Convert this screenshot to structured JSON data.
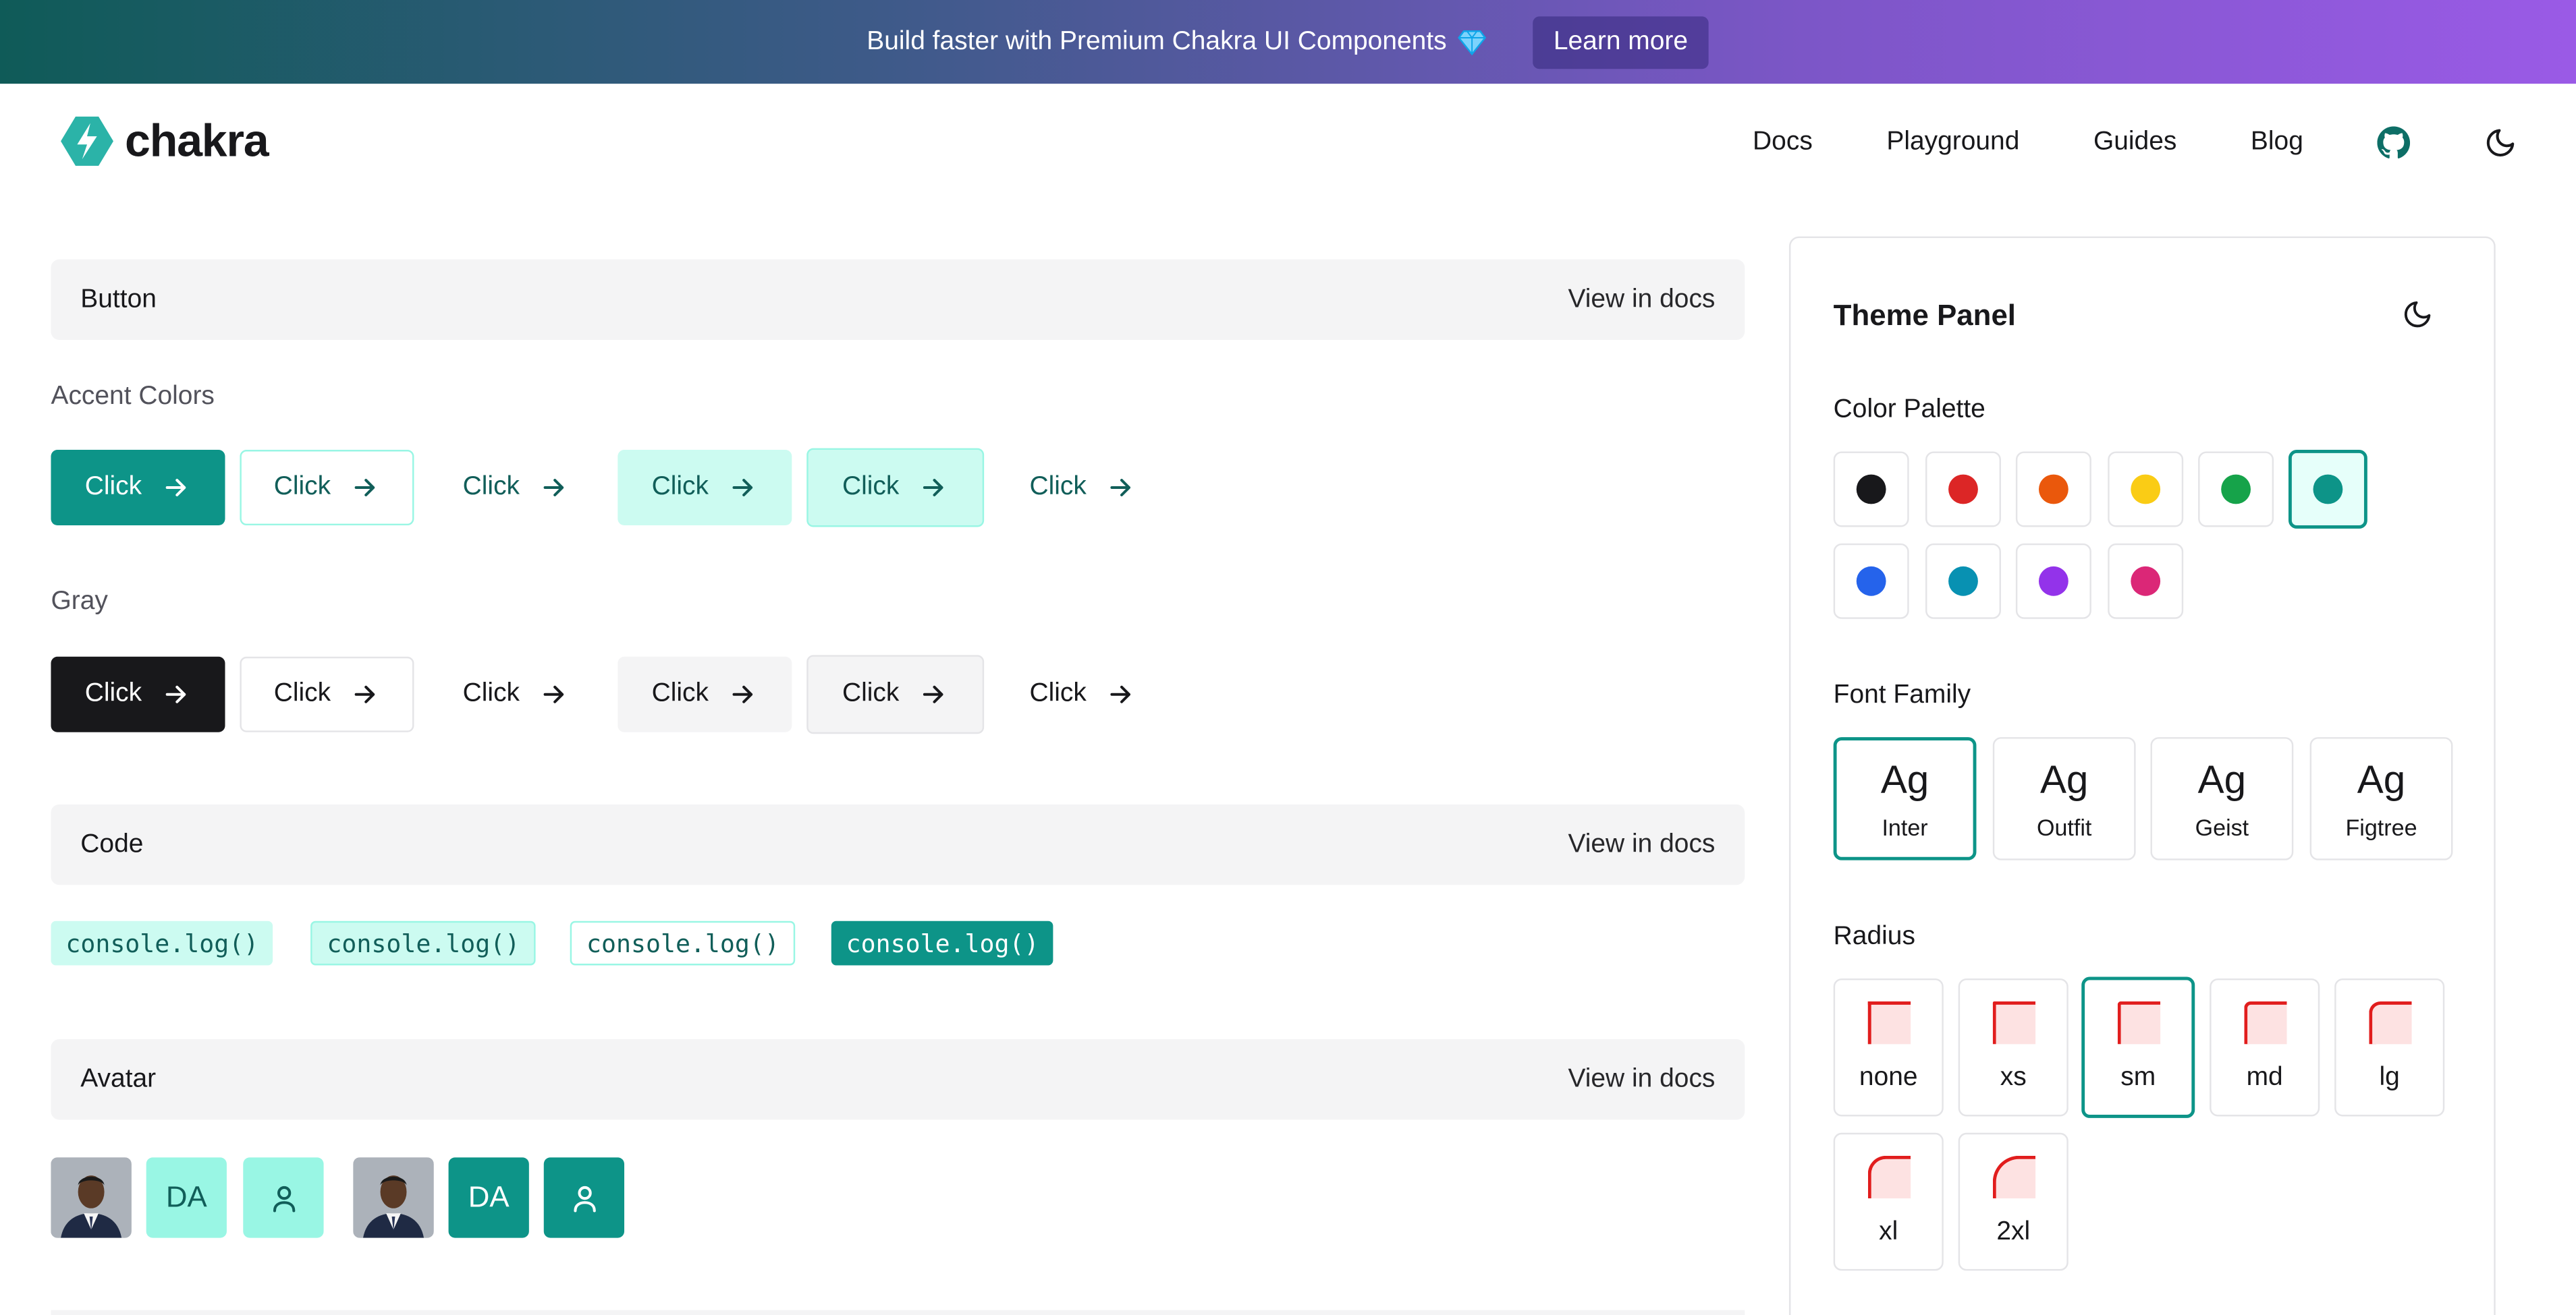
{
  "banner": {
    "text": "Build faster with Premium Chakra UI Components",
    "cta": "Learn more",
    "gradient": [
      "#0f5b58",
      "#9a5ae6"
    ]
  },
  "header": {
    "logo_text": "chakra",
    "nav": [
      "Docs",
      "Playground",
      "Guides",
      "Blog"
    ],
    "icons": [
      "github-icon",
      "moon-icon"
    ]
  },
  "sections": {
    "button": {
      "title": "Button",
      "view_docs": "View in docs",
      "accent_label": "Accent Colors",
      "gray_label": "Gray",
      "button_label": "Click"
    },
    "code": {
      "title": "Code",
      "view_docs": "View in docs",
      "samples": [
        "console.log()",
        "console.log()",
        "console.log()",
        "console.log()"
      ]
    },
    "avatar": {
      "title": "Avatar",
      "view_docs": "View in docs",
      "initials": "DA"
    }
  },
  "theme_panel": {
    "title": "Theme Panel",
    "color_palette_label": "Color Palette",
    "colors": [
      "#18181b",
      "#dc2626",
      "#ea580c",
      "#facc15",
      "#16a34a",
      "#0d9488",
      "#2563eb",
      "#0891b2",
      "#9333ea",
      "#db2777"
    ],
    "selected_color": "#0d9488",
    "font_family_label": "Font Family",
    "font_sample": "Ag",
    "fonts": [
      "Inter",
      "Outfit",
      "Geist",
      "Figtree"
    ],
    "selected_font": "Inter",
    "radius_label": "Radius",
    "radii": [
      "none",
      "xs",
      "sm",
      "md",
      "lg",
      "xl",
      "2xl"
    ],
    "selected_radius": "sm"
  },
  "accent_color": "#0d9488"
}
